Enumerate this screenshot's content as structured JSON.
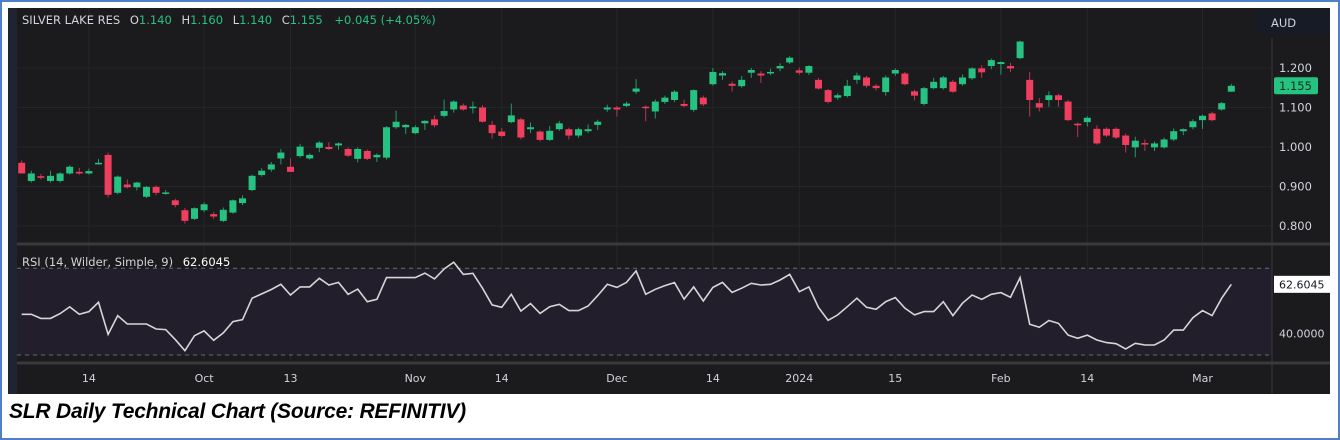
{
  "header": {
    "symbol": "SILVER LAKE RES",
    "o_label": "O",
    "o_value": "1.140",
    "h_label": "H",
    "h_value": "1.160",
    "l_label": "L",
    "l_value": "1.140",
    "c_label": "C",
    "c_value": "1.155",
    "change": "+0.045 (+4.05%)"
  },
  "currency_button": "AUD",
  "last_price_label": "1.155",
  "rsi": {
    "title": "RSI (14, Wilder, Simple, 9)",
    "value": "62.6045",
    "axis_label": "40.0000"
  },
  "caption": "SLR Daily Technical Chart (Source: REFINITIV)",
  "colors": {
    "up": "#26c281",
    "down": "#ef3e5e",
    "background": "#1b1b1d",
    "rsi_band": "#221e2b",
    "rsi_line": "#d6d6d6"
  },
  "chart_data": [
    {
      "type": "candlestick",
      "title": "SILVER LAKE RES",
      "ylabel": "AUD",
      "ylim": [
        0.75,
        1.28
      ],
      "yticks": [
        "1.200",
        "1.100",
        "1.000",
        "0.900",
        "0.800"
      ],
      "ytick_values": [
        1.2,
        1.1,
        1.0,
        0.9,
        0.8
      ],
      "xticks": [
        {
          "label": "14",
          "index": 7
        },
        {
          "label": "Oct",
          "index": 19
        },
        {
          "label": "13",
          "index": 28
        },
        {
          "label": "Nov",
          "index": 41
        },
        {
          "label": "14",
          "index": 50
        },
        {
          "label": "Dec",
          "index": 62
        },
        {
          "label": "14",
          "index": 72
        },
        {
          "label": "2024",
          "index": 81
        },
        {
          "label": "15",
          "index": 91
        },
        {
          "label": "Feb",
          "index": 102
        },
        {
          "label": "14",
          "index": 111
        },
        {
          "label": "Mar",
          "index": 123
        }
      ],
      "grid": true,
      "ohlc": [
        [
          0.96,
          0.966,
          0.945,
          0.933
        ],
        [
          0.914,
          0.94,
          0.91,
          0.933
        ],
        [
          0.926,
          0.932,
          0.918,
          0.924
        ],
        [
          0.914,
          0.94,
          0.91,
          0.927
        ],
        [
          0.914,
          0.936,
          0.91,
          0.933
        ],
        [
          0.933,
          0.954,
          0.93,
          0.95
        ],
        [
          0.937,
          0.947,
          0.93,
          0.933
        ],
        [
          0.933,
          0.945,
          0.93,
          0.939
        ],
        [
          0.958,
          0.97,
          0.955,
          0.96
        ],
        [
          0.98,
          0.986,
          0.872,
          0.879
        ],
        [
          0.884,
          0.928,
          0.88,
          0.925
        ],
        [
          0.905,
          0.918,
          0.895,
          0.898
        ],
        [
          0.898,
          0.912,
          0.89,
          0.91
        ],
        [
          0.874,
          0.901,
          0.871,
          0.899
        ],
        [
          0.899,
          0.903,
          0.878,
          0.884
        ],
        [
          0.883,
          0.891,
          0.879,
          0.885
        ],
        [
          0.865,
          0.869,
          0.847,
          0.853
        ],
        [
          0.84,
          0.846,
          0.806,
          0.813
        ],
        [
          0.818,
          0.847,
          0.815,
          0.845
        ],
        [
          0.84,
          0.86,
          0.835,
          0.855
        ],
        [
          0.83,
          0.836,
          0.818,
          0.824
        ],
        [
          0.813,
          0.847,
          0.81,
          0.841
        ],
        [
          0.834,
          0.867,
          0.831,
          0.865
        ],
        [
          0.858,
          0.878,
          0.853,
          0.87
        ],
        [
          0.891,
          0.93,
          0.888,
          0.927
        ],
        [
          0.929,
          0.946,
          0.925,
          0.94
        ],
        [
          0.943,
          0.962,
          0.937,
          0.956
        ],
        [
          0.971,
          0.995,
          0.956,
          0.986
        ],
        [
          0.95,
          0.971,
          0.945,
          0.937
        ],
        [
          0.977,
          1.008,
          0.973,
          1.001
        ],
        [
          0.971,
          0.984,
          0.968,
          0.98
        ],
        [
          0.998,
          1.015,
          0.987,
          1.011
        ],
        [
          1.0,
          1.012,
          0.992,
          0.995
        ],
        [
          1.004,
          1.012,
          0.993,
          1.009
        ],
        [
          0.995,
          0.999,
          0.975,
          0.978
        ],
        [
          0.97,
          0.999,
          0.961,
          0.995
        ],
        [
          0.99,
          0.994,
          0.967,
          0.97
        ],
        [
          0.974,
          0.984,
          0.962,
          0.98
        ],
        [
          0.973,
          1.053,
          0.968,
          1.05
        ],
        [
          1.05,
          1.092,
          1.046,
          1.064
        ],
        [
          1.05,
          1.058,
          1.033,
          1.056
        ],
        [
          1.035,
          1.055,
          1.032,
          1.05
        ],
        [
          1.06,
          1.068,
          1.043,
          1.066
        ],
        [
          1.07,
          1.08,
          1.05,
          1.055
        ],
        [
          1.079,
          1.12,
          1.075,
          1.091
        ],
        [
          1.095,
          1.118,
          1.087,
          1.115
        ],
        [
          1.105,
          1.11,
          1.092,
          1.095
        ],
        [
          1.101,
          1.115,
          1.085,
          1.102
        ],
        [
          1.1,
          1.106,
          1.062,
          1.064
        ],
        [
          1.056,
          1.066,
          1.021,
          1.035
        ],
        [
          1.039,
          1.048,
          1.025,
          1.028
        ],
        [
          1.063,
          1.11,
          1.06,
          1.08
        ],
        [
          1.07,
          1.074,
          1.019,
          1.024
        ],
        [
          1.045,
          1.062,
          1.035,
          1.05
        ],
        [
          1.039,
          1.042,
          1.014,
          1.018
        ],
        [
          1.018,
          1.053,
          1.015,
          1.041
        ],
        [
          1.045,
          1.066,
          1.041,
          1.06
        ],
        [
          1.045,
          1.049,
          1.019,
          1.029
        ],
        [
          1.029,
          1.049,
          1.023,
          1.045
        ],
        [
          1.04,
          1.057,
          1.035,
          1.045
        ],
        [
          1.056,
          1.069,
          1.043,
          1.064
        ],
        [
          1.095,
          1.107,
          1.089,
          1.1
        ],
        [
          1.1,
          1.104,
          1.077,
          1.095
        ],
        [
          1.104,
          1.115,
          1.101,
          1.11
        ],
        [
          1.14,
          1.172,
          1.134,
          1.148
        ],
        [
          1.102,
          1.105,
          1.065,
          1.1
        ],
        [
          1.09,
          1.12,
          1.072,
          1.115
        ],
        [
          1.114,
          1.13,
          1.109,
          1.125
        ],
        [
          1.119,
          1.144,
          1.114,
          1.14
        ],
        [
          1.109,
          1.12,
          1.101,
          1.104
        ],
        [
          1.094,
          1.146,
          1.089,
          1.144
        ],
        [
          1.125,
          1.13,
          1.103,
          1.108
        ],
        [
          1.159,
          1.2,
          1.155,
          1.19
        ],
        [
          1.181,
          1.192,
          1.17,
          1.187
        ],
        [
          1.16,
          1.166,
          1.14,
          1.155
        ],
        [
          1.154,
          1.18,
          1.15,
          1.17
        ],
        [
          1.188,
          1.2,
          1.175,
          1.195
        ],
        [
          1.186,
          1.192,
          1.162,
          1.181
        ],
        [
          1.19,
          1.198,
          1.182,
          1.19
        ],
        [
          1.199,
          1.212,
          1.192,
          1.205
        ],
        [
          1.214,
          1.23,
          1.21,
          1.226
        ],
        [
          1.194,
          1.201,
          1.183,
          1.188
        ],
        [
          1.188,
          1.207,
          1.182,
          1.205
        ],
        [
          1.17,
          1.175,
          1.145,
          1.148
        ],
        [
          1.144,
          1.147,
          1.11,
          1.114
        ],
        [
          1.125,
          1.136,
          1.119,
          1.131
        ],
        [
          1.129,
          1.17,
          1.125,
          1.155
        ],
        [
          1.17,
          1.188,
          1.16,
          1.181
        ],
        [
          1.176,
          1.18,
          1.15,
          1.155
        ],
        [
          1.155,
          1.159,
          1.143,
          1.149
        ],
        [
          1.139,
          1.181,
          1.13,
          1.176
        ],
        [
          1.186,
          1.199,
          1.18,
          1.195
        ],
        [
          1.186,
          1.19,
          1.156,
          1.159
        ],
        [
          1.141,
          1.145,
          1.118,
          1.13
        ],
        [
          1.109,
          1.152,
          1.105,
          1.149
        ],
        [
          1.149,
          1.175,
          1.146,
          1.165
        ],
        [
          1.149,
          1.18,
          1.145,
          1.176
        ],
        [
          1.165,
          1.17,
          1.137,
          1.14
        ],
        [
          1.159,
          1.184,
          1.155,
          1.176
        ],
        [
          1.174,
          1.202,
          1.17,
          1.199
        ],
        [
          1.199,
          1.207,
          1.175,
          1.189
        ],
        [
          1.205,
          1.224,
          1.197,
          1.22
        ],
        [
          1.21,
          1.217,
          1.183,
          1.215
        ],
        [
          1.205,
          1.213,
          1.19,
          1.199
        ],
        [
          1.225,
          1.269,
          1.222,
          1.267
        ],
        [
          1.17,
          1.19,
          1.077,
          1.119
        ],
        [
          1.111,
          1.124,
          1.09,
          1.1
        ],
        [
          1.119,
          1.141,
          1.102,
          1.131
        ],
        [
          1.131,
          1.135,
          1.102,
          1.119
        ],
        [
          1.115,
          1.119,
          1.066,
          1.068
        ],
        [
          1.059,
          1.062,
          1.025,
          1.055
        ],
        [
          1.063,
          1.078,
          1.052,
          1.074
        ],
        [
          1.046,
          1.055,
          1.006,
          1.009
        ],
        [
          1.046,
          1.05,
          1.025,
          1.029
        ],
        [
          1.046,
          1.05,
          1.02,
          1.024
        ],
        [
          1.029,
          1.034,
          0.986,
          1.005
        ],
        [
          0.999,
          1.026,
          0.974,
          1.016
        ],
        [
          1.01,
          1.019,
          0.99,
          1.009
        ],
        [
          0.999,
          1.014,
          0.99,
          1.009
        ],
        [
          0.999,
          1.024,
          0.996,
          1.019
        ],
        [
          1.019,
          1.047,
          1.015,
          1.04
        ],
        [
          1.04,
          1.047,
          1.03,
          1.045
        ],
        [
          1.05,
          1.07,
          1.045,
          1.065
        ],
        [
          1.068,
          1.082,
          1.046,
          1.079
        ],
        [
          1.085,
          1.089,
          1.065,
          1.068
        ],
        [
          1.095,
          1.114,
          1.092,
          1.111
        ],
        [
          1.14,
          1.16,
          1.14,
          1.155
        ]
      ],
      "last_price": 1.155
    },
    {
      "type": "line",
      "title": "RSI (14, Wilder, Simple, 9)",
      "ylim": [
        30,
        70
      ],
      "bands": [
        30,
        70
      ],
      "ytick_values": [
        40
      ],
      "series": [
        {
          "name": "RSI",
          "values": [
            48.8,
            48.8,
            46.9,
            46.9,
            49.1,
            52.2,
            48.8,
            50.0,
            54.3,
            39.5,
            48.2,
            44.3,
            44.3,
            44.3,
            42.0,
            41.7,
            37.1,
            32.0,
            38.9,
            41.1,
            36.8,
            40.2,
            45.4,
            46.3,
            56.2,
            58.2,
            60.2,
            62.6,
            57.7,
            61.4,
            61.4,
            65.4,
            62.3,
            63.5,
            58.0,
            60.4,
            54.6,
            55.7,
            65.7,
            65.7,
            65.7,
            65.7,
            67.8,
            65.1,
            69.7,
            72.8,
            67.2,
            67.7,
            60.8,
            53.1,
            52.0,
            58.0,
            50.3,
            53.7,
            49.2,
            52.3,
            53.4,
            50.5,
            50.5,
            52.6,
            57.4,
            62.6,
            61.2,
            63.5,
            68.8,
            58.0,
            60.3,
            62.0,
            63.4,
            55.8,
            61.4,
            54.9,
            61.2,
            63.5,
            58.9,
            60.8,
            63.1,
            62.3,
            62.6,
            64.6,
            67.2,
            59.2,
            61.4,
            51.9,
            46.0,
            48.5,
            52.3,
            56.2,
            52.0,
            51.1,
            54.6,
            56.5,
            51.6,
            48.5,
            50.0,
            50.0,
            54.6,
            48.2,
            53.9,
            57.7,
            55.7,
            58.0,
            58.8,
            56.6,
            65.7,
            44.2,
            42.8,
            45.9,
            44.6,
            39.2,
            37.7,
            39.2,
            36.9,
            35.7,
            35.2,
            32.8,
            35.4,
            34.6,
            34.6,
            36.9,
            41.5,
            41.5,
            47.2,
            50.5,
            48.2,
            56.2,
            62.6
          ]
        }
      ],
      "last_value": 62.6045
    }
  ]
}
